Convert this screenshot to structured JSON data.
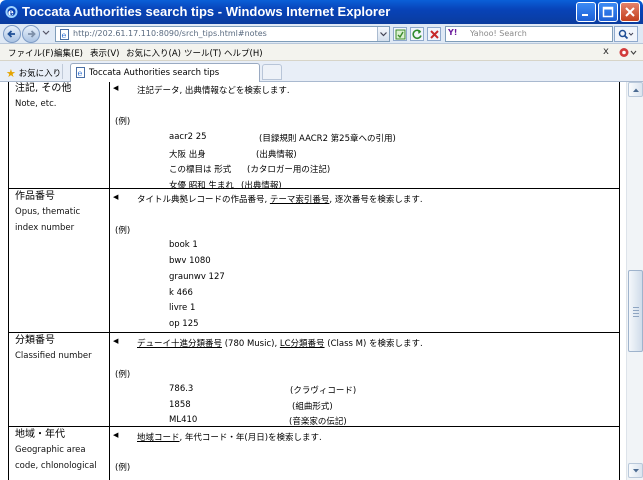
{
  "window": {
    "title": "Toccata Authorities search tips - Windows Internet Explorer"
  },
  "addressbar": {
    "url": "http://202.61.17.110:8090/srch_tips.html#notes",
    "search_placeholder": "Yahoo! Search",
    "search_logo": "Y!"
  },
  "menu": {
    "items": [
      "ファイル(F)",
      "編集(E)",
      "表示(V)",
      "お気に入り(A)",
      "ツール(T)",
      "ヘルプ(H)"
    ],
    "close_x": "x"
  },
  "tabs": {
    "favorites": "お気に入り",
    "active_tab": "Toccata Authorities search tips"
  },
  "rows": [
    {
      "jp": "注記, その他",
      "en": [
        "Note, etc."
      ],
      "desc": "注記データ, 出典情報などを検索します.",
      "rei": "(例)",
      "examples": [
        {
          "code": "aacr2 25",
          "note": "(目録規則 AACR2 第25章への引用)"
        },
        {
          "code": "大阪 出身",
          "note": "(出典情報)"
        },
        {
          "code": "この標目は 形式",
          "note": "(カタロガー用の注記)"
        },
        {
          "code": "女優 昭和 生まれ",
          "note": "(出典情報)"
        }
      ]
    },
    {
      "jp": "作品番号",
      "en": [
        "Opus, thematic",
        "index number"
      ],
      "desc_parts": [
        "タイトル典拠レコードの作品番号, ",
        "テーマ索引番号",
        ", 逐次番号を検索します."
      ],
      "rei": "(例)",
      "examples": [
        "book 1",
        "bwv 1080",
        "graunwv 127",
        "k 466",
        "livre 1",
        "op 125"
      ]
    },
    {
      "jp": "分類番号",
      "en": [
        "Classified number"
      ],
      "desc_parts": [
        "デューイ十進分類番号",
        " (780 Music), ",
        "LC分類番号",
        " (Class M)",
        " を検索します."
      ],
      "rei": "(例)",
      "examples": [
        {
          "code": "786.3",
          "note": "(クラヴィコード)"
        },
        {
          "code": "1858",
          "note": "(組曲形式)"
        },
        {
          "code": "ML410",
          "note": "(音楽家の伝記)"
        }
      ]
    },
    {
      "jp": "地域・年代",
      "en": [
        "Geographic area",
        "code, chlonological"
      ],
      "desc_parts": [
        "地域コード",
        ", 年代コード・年(月日)を検索します."
      ],
      "rei": "(例)"
    }
  ]
}
